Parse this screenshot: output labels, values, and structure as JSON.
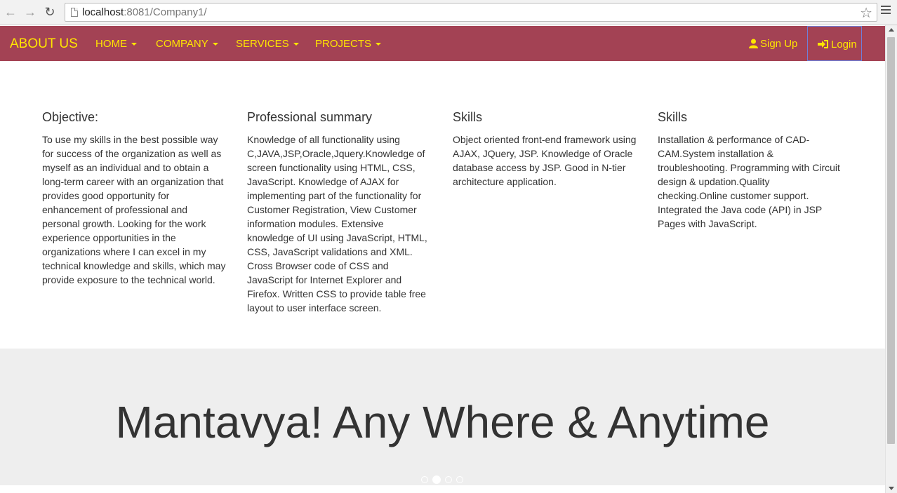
{
  "browser": {
    "url_host": "localhost",
    "url_path": ":8081/Company1/"
  },
  "navbar": {
    "brand": "ABOUT US",
    "items": [
      {
        "label": "HOME"
      },
      {
        "label": "COMPANY"
      },
      {
        "label": "SERVICES"
      },
      {
        "label": "PROJECTS"
      }
    ],
    "signup": "Sign Up",
    "login": "Login",
    "bg_color": "#a34254",
    "text_color": "#ffe600"
  },
  "columns": [
    {
      "title": "Objective:",
      "body": "To use my skills in the best possible way for success of the organization as well as myself as an individual and to obtain a long-term career with an organization that provides good opportunity for enhancement of professional and personal growth. Looking for the work experience opportunities in the organizations where I can excel in my technical knowledge and skills, which may provide exposure to the technical world."
    },
    {
      "title": "Professional summary",
      "body": "Knowledge of all functionality using C,JAVA,JSP,Oracle,Jquery.Knowledge of screen functionality using HTML, CSS, JavaScript. Knowledge of AJAX for implementing part of the functionality for Customer Registration, View Customer information modules. Extensive knowledge of UI using JavaScript, HTML, CSS, JavaScript validations and XML. Cross Browser code of CSS and JavaScript for Internet Explorer and Firefox. Written CSS to provide table free layout to user interface screen."
    },
    {
      "title": "Skills",
      "body": "Object oriented front-end framework using AJAX, JQuery, JSP. Knowledge of Oracle database access by JSP. Good in N-tier architecture application."
    },
    {
      "title": "Skills",
      "body": "Installation & performance of CAD-CAM.System installation & troubleshooting. Programming with Circuit design & updation.Quality checking.Online customer support. Integrated the Java code (API) in JSP Pages with JavaScript."
    }
  ],
  "carousel": {
    "text": "Mantavya! Any Where & Anytime",
    "slide_count": 4,
    "active_index": 1
  }
}
